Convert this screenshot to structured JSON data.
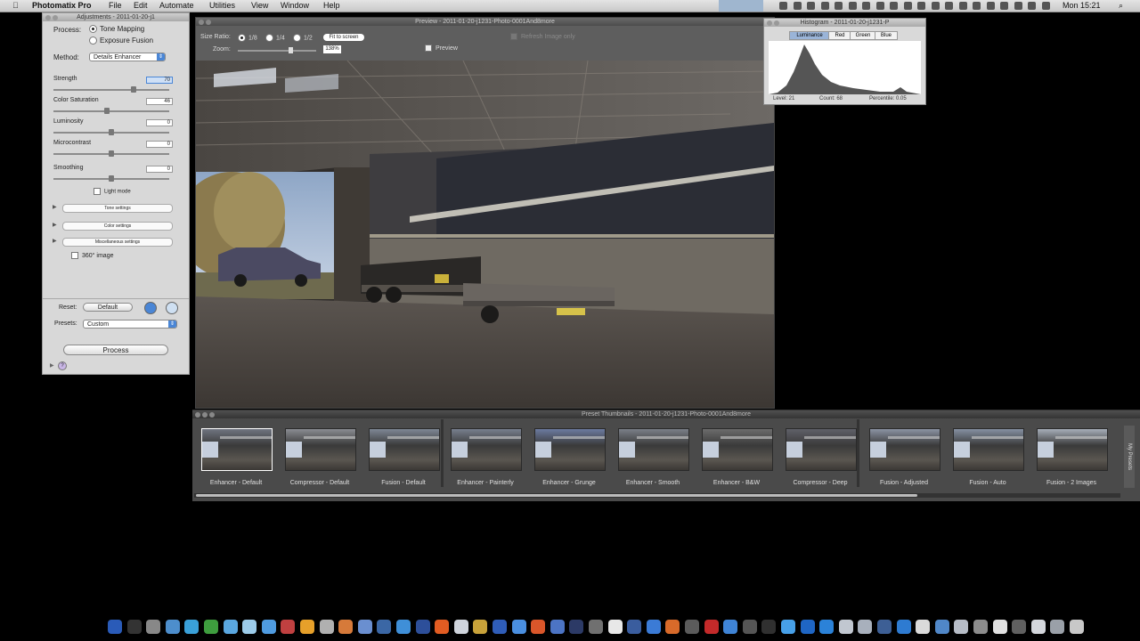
{
  "menubar": {
    "apple": "",
    "app_name": "Photomatix Pro",
    "items": [
      "File",
      "Edit",
      "Automate",
      "Utilities",
      "View",
      "Window",
      "Help"
    ],
    "clock": "Mon 15:21",
    "spotlight": "⌕"
  },
  "adjustments": {
    "title": "Adjustments - 2011-01-20-j1",
    "process_label": "Process:",
    "process_options": [
      "Tone Mapping",
      "Exposure Fusion"
    ],
    "method_label": "Method:",
    "method_value": "Details Enhancer",
    "sliders": [
      {
        "label": "Strength",
        "value": "70",
        "level": 0.7
      },
      {
        "label": "Color Saturation",
        "value": "46",
        "level": 0.46
      },
      {
        "label": "Luminosity",
        "value": "0",
        "level": 0.5
      },
      {
        "label": "Microcontrast",
        "value": "0",
        "level": 0.5
      },
      {
        "label": "Smoothing",
        "value": "0",
        "level": 0.5
      }
    ],
    "light_mode_label": "Light mode",
    "sections": [
      "Tone settings",
      "Color settings",
      "Miscellaneous settings"
    ],
    "option_360": "360° image",
    "reset_label": "Reset:",
    "reset_button": "Default",
    "presets_label": "Presets:",
    "presets_value": "Custom",
    "process_button": "Process",
    "help_icon": "?"
  },
  "preview": {
    "title": "Preview - 2011-01-20-j1231-Photo-0001And8more",
    "size_ratio_label": "Size Ratio:",
    "size_ratio_options": [
      "1/8",
      "1/4",
      "1/2"
    ],
    "fit_button": "Fit to screen",
    "zoom_label": "Zoom:",
    "zoom_value": "138%",
    "preview_checkbox": "Preview",
    "refresh_label": "Refresh Image only"
  },
  "histogram": {
    "title": "Histogram - 2011-01-20-j1231-P",
    "tabs": [
      "Luminance",
      "Red",
      "Green",
      "Blue"
    ],
    "level": "Level: 21",
    "count": "Count: 68",
    "percentile": "Percentile: 0.05"
  },
  "thumbnails": {
    "title": "Preset Thumbnails - 2011-01-20-j1231-Photo-0001And8more",
    "items": [
      {
        "label": "Enhancer - Default",
        "tone": "#6f7480"
      },
      {
        "label": "Compressor - Default",
        "tone": "#8a8c92"
      },
      {
        "label": "Fusion - Default",
        "tone": "#7e8795"
      },
      {
        "label": "Enhancer - Painterly",
        "tone": "#777f8e"
      },
      {
        "label": "Enhancer - Grunge",
        "tone": "#6b7aa0"
      },
      {
        "label": "Enhancer - Smooth",
        "tone": "#7a7f88"
      },
      {
        "label": "Enhancer - B&W",
        "tone": "#6c6c6c"
      },
      {
        "label": "Compressor - Deep",
        "tone": "#5f6068"
      },
      {
        "label": "Fusion - Adjusted",
        "tone": "#8b93a3"
      },
      {
        "label": "Fusion - Auto",
        "tone": "#8590a2"
      },
      {
        "label": "Fusion - 2 Images",
        "tone": "#a7aeb9"
      }
    ],
    "side_tab": "My Presets"
  },
  "dock": {
    "colors": [
      "#2a5bb8",
      "#333",
      "#888",
      "#4d8ecc",
      "#3aa0d8",
      "#3e9d3e",
      "#5aa7e0",
      "#9ccbe9",
      "#4f9be0",
      "#c04040",
      "#e6a02a",
      "#b0b0b0",
      "#d67a3a",
      "#6a8fd0",
      "#3b67a5",
      "#3f8fd8",
      "#2d4f9a",
      "#e25c22",
      "#cfd4dc",
      "#c8a23a",
      "#2f5db8",
      "#4a8fe0",
      "#d9562a",
      "#4c74c4",
      "#2c3a66",
      "#707070",
      "#e8e8e8",
      "#3a5d9e",
      "#3b7bd6",
      "#d86a2a",
      "#5b5b5b",
      "#c42a2a",
      "#3f84d6",
      "#555",
      "#303030",
      "#47a0e8",
      "#1f66c4",
      "#2b82d8",
      "#c1c7d0",
      "#a8b0bc",
      "#3d5f95",
      "#2e7bd1",
      "#dadada",
      "#5087c8",
      "#b6bcc6",
      "#8c8c8c",
      "#e0e0e0",
      "#606060",
      "#d3d6db",
      "#9aa0a8",
      "#c8c8c8"
    ]
  }
}
